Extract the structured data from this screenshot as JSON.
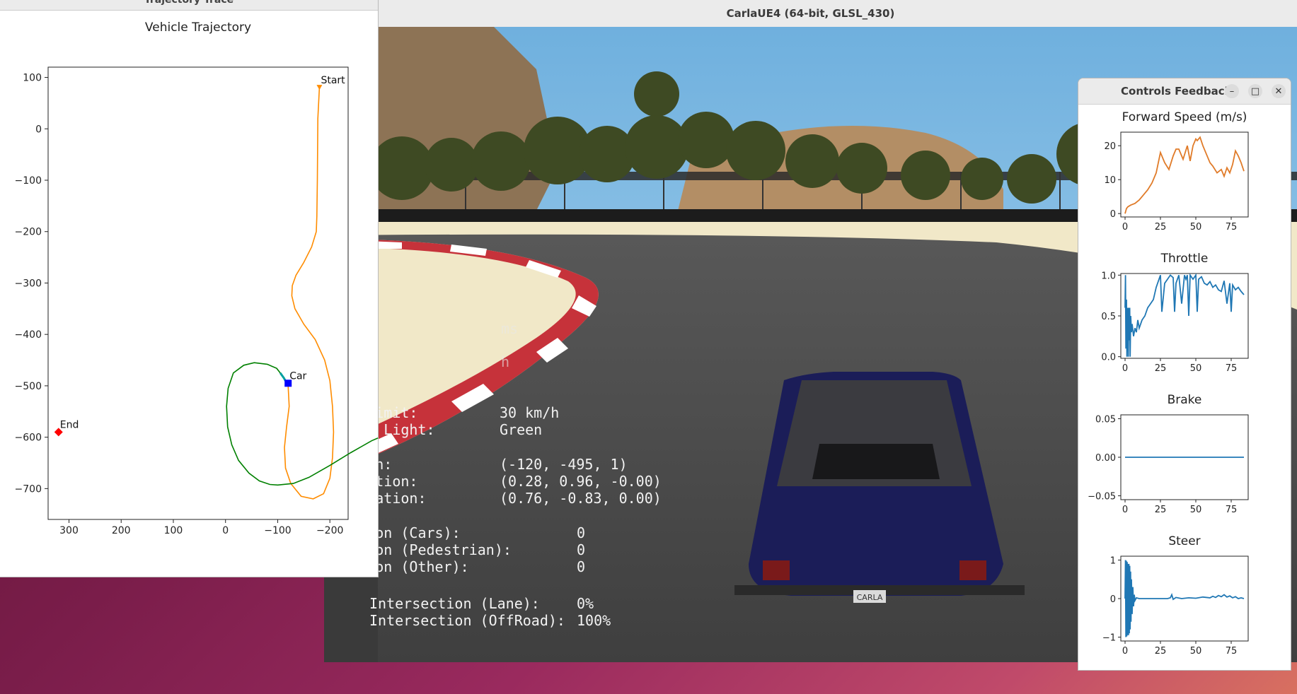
{
  "desktop": {
    "background": "#7a1d4a"
  },
  "carla_window": {
    "title": "CarlaUE4 (64-bit, GLSL_430)",
    "hud": {
      "faded_line_1": "ms",
      "faded_line_2": "h",
      "speed_limit_label": "peed Limit:",
      "speed_limit_value": "30 km/h",
      "traffic_light_label": "raffic Light:",
      "traffic_light_value": "Green",
      "location_label": "ocation:",
      "location_value": "(-120, -495, 1)",
      "orientation_label": "rientation:",
      "orientation_value": "(0.28, 0.96, -0.00)",
      "acceleration_label": "cceleration:",
      "acceleration_value": "(0.76, -0.83, 0.00)",
      "collision_cars_label": "ollision (Cars):",
      "collision_cars_value": "0",
      "collision_ped_label": "ollision (Pedestrian):",
      "collision_ped_value": "0",
      "collision_other_label": "ollision (Other):",
      "collision_other_value": "0",
      "intersection_lane_label": "Intersection (Lane):",
      "intersection_lane_value": "0%",
      "intersection_offroad_label": "Intersection (OffRoad):",
      "intersection_offroad_value": "100%"
    },
    "car_plate": "CARLA"
  },
  "trajectory_window": {
    "window_title": "Trajectory Trace",
    "chart_data": {
      "type": "line",
      "title": "Vehicle Trajectory",
      "xlim": [
        340,
        -235
      ],
      "ylim": [
        -760,
        120
      ],
      "x_ticks": [
        300,
        200,
        100,
        0,
        -100,
        -200
      ],
      "y_ticks": [
        100,
        0,
        -100,
        -200,
        -300,
        -400,
        -500,
        -600,
        -700
      ],
      "series": [
        {
          "color": "#ff8c00",
          "points": [
            [
              -180,
              80
            ],
            [
              -177,
              20
            ],
            [
              -176,
              -100
            ],
            [
              -175,
              -170
            ],
            [
              -174,
              -200
            ],
            [
              -165,
              -230
            ],
            [
              -150,
              -260
            ],
            [
              -135,
              -285
            ],
            [
              -128,
              -305
            ],
            [
              -127,
              -325
            ],
            [
              -133,
              -350
            ],
            [
              -150,
              -380
            ],
            [
              -172,
              -410
            ],
            [
              -190,
              -450
            ],
            [
              -200,
              -490
            ],
            [
              -205,
              -540
            ],
            [
              -207,
              -590
            ],
            [
              -205,
              -640
            ],
            [
              -200,
              -680
            ],
            [
              -188,
              -710
            ],
            [
              -168,
              -720
            ],
            [
              -145,
              -715
            ],
            [
              -125,
              -690
            ],
            [
              -115,
              -660
            ],
            [
              -113,
              -620
            ],
            [
              -117,
              -580
            ],
            [
              -122,
              -540
            ],
            [
              -120,
              -500
            ]
          ]
        },
        {
          "color": "#00a0a0",
          "points": [
            [
              -120,
              -500
            ],
            [
              -112,
              -485
            ],
            [
              -105,
              -475
            ]
          ]
        },
        {
          "color": "#008000",
          "points": [
            [
              -105,
              -475
            ],
            [
              -98,
              -466
            ],
            [
              -80,
              -458
            ],
            [
              -55,
              -455
            ],
            [
              -35,
              -460
            ],
            [
              -15,
              -475
            ],
            [
              -5,
              -505
            ],
            [
              -2,
              -540
            ],
            [
              -4,
              -580
            ],
            [
              -12,
              -615
            ],
            [
              -25,
              -645
            ],
            [
              -45,
              -670
            ],
            [
              -65,
              -685
            ],
            [
              -85,
              -692
            ],
            [
              -100,
              -693
            ],
            [
              -130,
              -690
            ],
            [
              -160,
              -678
            ],
            [
              -200,
              -655
            ],
            [
              -240,
              -630
            ],
            [
              -280,
              -607
            ],
            [
              -305,
              -596
            ],
            [
              -318,
              -592
            ],
            [
              -325,
              -590
            ]
          ]
        }
      ],
      "markers": [
        {
          "label": "Start",
          "x": -180,
          "y": 80,
          "color": "#ff8c00"
        },
        {
          "label": "Car",
          "x": -120,
          "y": -495,
          "color": "#0000ff"
        },
        {
          "label": "End",
          "x": 320,
          "y": -590,
          "color": "#ff0000"
        }
      ]
    }
  },
  "controls_window": {
    "title": "Controls Feedback",
    "buttons": {
      "minimize": "–",
      "maximize": "□",
      "close": "✕"
    },
    "chart_data": [
      {
        "type": "line",
        "title": "Forward Speed (m/s)",
        "color": "#e07b29",
        "xlim": [
          -3,
          87
        ],
        "ylim": [
          -1,
          24
        ],
        "x_ticks": [
          0,
          25,
          50,
          75
        ],
        "y_ticks": [
          0,
          10,
          20
        ],
        "x": [
          0,
          1,
          2,
          4,
          7,
          10,
          13,
          16,
          19,
          22,
          25,
          28,
          31,
          34,
          36,
          38,
          40,
          41,
          44,
          46,
          48,
          50,
          51,
          53,
          55,
          57,
          60,
          62,
          65,
          68,
          70,
          72,
          74,
          76,
          78,
          80,
          82,
          84
        ],
        "y": [
          0,
          1.5,
          2,
          2.5,
          3,
          4,
          5.5,
          7,
          9,
          12,
          18,
          15,
          13,
          17,
          19,
          19,
          17,
          16,
          20,
          15.5,
          20,
          22,
          21.5,
          22.5,
          20,
          18,
          15,
          14,
          12,
          13,
          11,
          13.5,
          12,
          14.5,
          18.5,
          17,
          15,
          12.5
        ]
      },
      {
        "type": "line",
        "title": "Throttle",
        "color": "#1f77b4",
        "xlim": [
          -3,
          87
        ],
        "ylim": [
          -0.02,
          1.02
        ],
        "x_ticks": [
          0,
          25,
          50,
          75
        ],
        "y_ticks": [
          0.0,
          0.5,
          1.0
        ],
        "x": [
          0,
          0.3,
          0.6,
          1,
          1.3,
          1.6,
          2,
          2.3,
          2.6,
          3,
          3.3,
          3.6,
          4,
          4.5,
          5,
          6,
          7,
          8,
          9,
          10,
          12,
          14,
          16,
          18,
          20,
          22,
          25,
          26,
          28,
          30,
          32,
          34,
          35,
          36,
          38,
          40,
          42,
          43,
          44,
          45,
          46,
          48,
          50,
          51,
          52,
          54,
          56,
          58,
          60,
          62,
          64,
          66,
          68,
          70,
          72,
          74,
          75,
          76,
          78,
          80,
          82,
          84
        ],
        "y": [
          0.6,
          1.0,
          0.1,
          0.7,
          0.0,
          0.5,
          0.6,
          0.0,
          0.6,
          0.2,
          0.6,
          0.0,
          0.5,
          0.3,
          0.4,
          0.25,
          0.35,
          0.3,
          0.45,
          0.35,
          0.45,
          0.5,
          0.6,
          0.65,
          0.7,
          0.85,
          1.0,
          0.55,
          0.9,
          0.95,
          1.0,
          0.97,
          0.55,
          0.9,
          1.0,
          0.65,
          1.0,
          0.95,
          1.0,
          0.5,
          1.0,
          0.95,
          1.0,
          0.55,
          0.95,
          0.98,
          0.9,
          0.88,
          0.92,
          0.85,
          0.88,
          0.82,
          0.8,
          0.93,
          0.65,
          0.9,
          0.55,
          0.88,
          0.82,
          0.85,
          0.8,
          0.76
        ]
      },
      {
        "type": "line",
        "title": "Brake",
        "color": "#1f77b4",
        "xlim": [
          -3,
          87
        ],
        "ylim": [
          -0.055,
          0.055
        ],
        "x_ticks": [
          0,
          25,
          50,
          75
        ],
        "y_ticks": [
          0.05,
          0.0,
          -0.05
        ],
        "x": [
          0,
          84
        ],
        "y": [
          0,
          0
        ]
      },
      {
        "type": "line",
        "title": "Steer",
        "color": "#1f77b4",
        "xlim": [
          -3,
          87
        ],
        "ylim": [
          -1.1,
          1.1
        ],
        "x_ticks": [
          0,
          25,
          50,
          75
        ],
        "y_ticks": [
          1,
          0,
          -1
        ],
        "x": [
          0,
          0.3,
          0.6,
          0.9,
          1.2,
          1.5,
          1.8,
          2.1,
          2.4,
          2.7,
          3.0,
          3.3,
          3.6,
          3.9,
          4.2,
          4.5,
          5,
          5.5,
          6,
          6.5,
          7,
          8,
          10,
          15,
          20,
          25,
          30,
          32,
          33,
          34,
          36,
          40,
          45,
          50,
          55,
          60,
          62,
          64,
          66,
          68,
          70,
          72,
          74,
          76,
          78,
          80,
          82,
          84
        ],
        "y": [
          0,
          1.0,
          -1.0,
          0.98,
          -0.98,
          0.95,
          -0.95,
          0.9,
          -0.95,
          0.9,
          -0.9,
          0.85,
          -0.8,
          0.7,
          -0.6,
          0.5,
          -0.4,
          0.3,
          -0.2,
          0.1,
          -0.05,
          0.02,
          0,
          0,
          0,
          0,
          0,
          0.02,
          0.1,
          -0.02,
          0.03,
          0,
          0.02,
          0.01,
          0.04,
          0.02,
          0.06,
          0.03,
          0.08,
          0.05,
          0.1,
          0.04,
          0.07,
          0.02,
          0.05,
          0.0,
          0.02,
          0.0
        ]
      }
    ]
  }
}
